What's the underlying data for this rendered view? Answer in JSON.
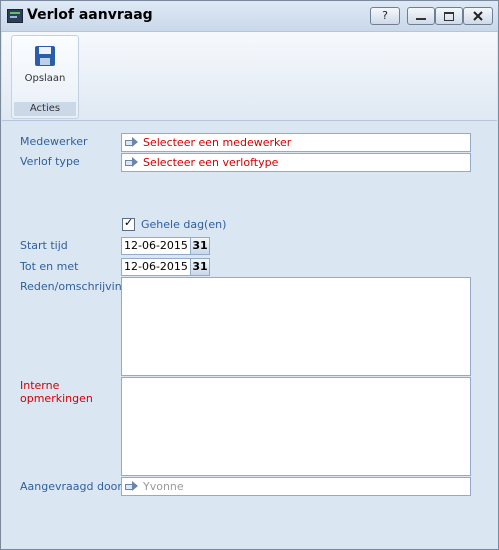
{
  "window": {
    "title": "Verlof aanvraag",
    "help_label": "?"
  },
  "ribbon": {
    "save_label": "Opslaan",
    "group_label": "Acties"
  },
  "form": {
    "employee": {
      "label": "Medewerker",
      "placeholder": "Selecteer een medewerker"
    },
    "leave_type": {
      "label": "Verlof type",
      "placeholder": "Selecteer een verloftype"
    },
    "full_day": {
      "label": "Gehele dag(en)",
      "checked": true
    },
    "start": {
      "label": "Start tijd",
      "value": "12-06-2015",
      "cal_label": "31"
    },
    "end": {
      "label": "Tot en met",
      "value": "12-06-2015",
      "cal_label": "31"
    },
    "reason": {
      "label": "Reden/omschrijving",
      "value": ""
    },
    "internal": {
      "label_line1": "Interne",
      "label_line2": "opmerkingen",
      "value": ""
    },
    "requested_by": {
      "label": "Aangevraagd door",
      "value": "Yvonne"
    }
  },
  "colors": {
    "label": "#2f5f9e",
    "required": "#d10000",
    "background": "#dbe6f3"
  }
}
